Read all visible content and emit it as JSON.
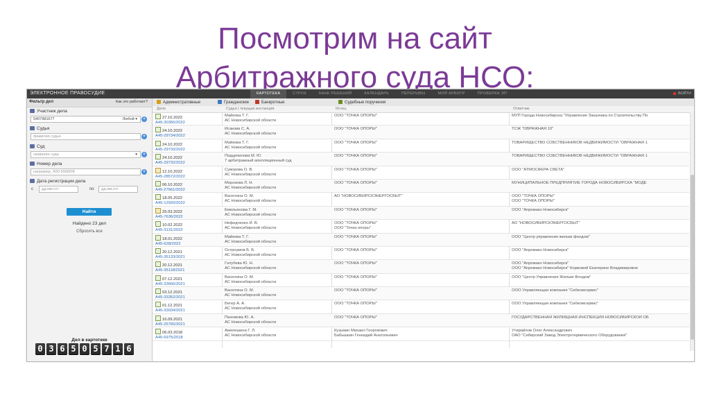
{
  "slide": {
    "title_line1": "Посмотрим на сайт",
    "title_line2": "Арбитражного суда НСО:"
  },
  "topbar": {
    "brand": "ЭЛЕКТРОННОЕ ПРАВОСУДИЕ",
    "nav": [
      "КАРТОТЕКА",
      "СТРОК",
      "БАНК РЕШЕНИЙ",
      "КАЛЕНДАРЬ",
      "ПЕРЕРЫВЫ",
      "МОЙ АРБИТР",
      "ПРОВЕРКА ЭП"
    ],
    "login": "ВОЙТИ"
  },
  "sidebar": {
    "title": "Фильтр дел",
    "help": "Как это работает?",
    "participant_label": "Участник дела",
    "participant_value": "5407981677",
    "participant_select": "Любой",
    "judge_label": "Судья",
    "judge_placeholder": "фамилия судьи",
    "court_label": "Суд",
    "court_placeholder": "название суда",
    "case_number_label": "Номер дела",
    "case_number_placeholder": "например, А50-5568/08",
    "reg_date_label": "Дата регистрации дела",
    "date_from": "с",
    "date_to": "по",
    "date_placeholder": "дд.мм.гггг",
    "find_button": "Найти",
    "found_text": "Найдено 23 дел",
    "reset_link": "Сбросить все",
    "counter_label": "Дел в картотеке",
    "counter_digits": [
      "0",
      "3",
      "6",
      "5",
      "0",
      "5",
      "7",
      "1",
      "6"
    ]
  },
  "tabs": [
    {
      "label": "Административные",
      "color": "#d4a017"
    },
    {
      "label": "Гражданские",
      "color": "#3b78c4"
    },
    {
      "label": "Банкротные",
      "color": "#c0392b"
    },
    {
      "label": "Судебные поручения",
      "color": "#6b8e23"
    }
  ],
  "columns": {
    "case": "Дело",
    "court": "Судья | текущая инстанция",
    "plaintiff": "Истец",
    "defendant": "Ответчик"
  },
  "rows": [
    {
      "date": "27.10.2022",
      "num": "А45-30365/2022",
      "judge": "Майкова Т. Г.",
      "court": "АС Новосибирской области",
      "plaintiff": "ООО \"ТОЧКА ОПОРЫ\"",
      "plaintiff2": "",
      "def": "МУП Города Новосибирска \"Управление Заказчика по Строительству По",
      "def2": ""
    },
    {
      "date": "24.10.2022",
      "num": "А45-29734/2022",
      "judge": "Исакова С. А.",
      "court": "АС Новосибирской области",
      "plaintiff": "ООО \"ТОЧКА ОПОРЫ\"",
      "plaintiff2": "",
      "def": "ТСЖ \"ОВРАЖНАЯ 10\"",
      "def2": ""
    },
    {
      "date": "24.10.2022",
      "num": "А45-29733/2022",
      "judge": "Майкова Т. Г.",
      "court": "АС Новосибирской области",
      "plaintiff": "ООО \"ТОЧКА ОПОРЫ\"",
      "plaintiff2": "",
      "def": "ТОВАРИЩЕСТВО СОБСТВЕННИКОВ НЕДВИЖИМОСТИ \"ОВРАЖНАЯ 1",
      "def2": ""
    },
    {
      "date": "24.10.2022",
      "num": "А45-29732/2022",
      "judge": "Подцепилова М. Ю.",
      "court": "7 арбитражный апелляционный суд",
      "plaintiff": "ООО \"ТОЧКА ОПОРЫ\"",
      "plaintiff2": "",
      "def": "ТОВАРИЩЕСТВО СОБСТВЕННИКОВ НЕДВИЖИМОСТИ \"ОВРАЖНАЯ 1",
      "def2": ""
    },
    {
      "date": "12.10.2022",
      "num": "А45-28572/2022",
      "judge": "Суворова О. В.",
      "court": "АС Новосибирской области",
      "plaintiff": "ООО \"ТОЧКА ОПОРЫ\"",
      "plaintiff2": "",
      "def": "ООО \"АТМОСФЕРА СВЕТА\"",
      "def2": "",
      "alt": true
    },
    {
      "date": "06.10.2022",
      "num": "А45-27661/2022",
      "judge": "Морозова Л. Н.",
      "court": "АС Новосибирской области",
      "plaintiff": "ООО \"ТОЧКА ОПОРЫ\"",
      "plaintiff2": "",
      "def": "МУНИЦИПАЛЬНОЕ ПРЕДПРИЯТИЕ ГОРОДА НОВОСИБИРСКА \"МОДЕ",
      "def2": ""
    },
    {
      "date": "18.05.2022",
      "num": "А45-12920/2022",
      "judge": "Васютина О. М.",
      "court": "АС Новосибирской области",
      "plaintiff": "АО \"НОВОСИБИРСКЭНЕРГОСБЫТ\"",
      "plaintiff2": "",
      "def": "ООО \"ТОЧКА ОПОРЫ\"",
      "def2": "ООО \"ТОЧКА ОПОРЫ\""
    },
    {
      "date": "25.03.2022",
      "num": "А45-7636/2022",
      "judge": "Емельянова Г. М.",
      "court": "АС Новосибирской области",
      "plaintiff": "ООО \"ТОЧКА ОПОРЫ\"",
      "plaintiff2": "",
      "def": "ООО \"Апромако Новосибирск\"",
      "def2": "",
      "alt": true
    },
    {
      "date": "10.02.2022",
      "num": "А45-3131/2022",
      "judge": "Нефедченко И. В.",
      "court": "АС Новосибирской области",
      "plaintiff": "ООО \"ТОЧКА ОПОРЫ\"",
      "plaintiff2": "ООО \"Точка опоры\"",
      "def": "АО \"НОВОСИБИРСКЭНЕРГОСБЫТ\"",
      "def2": ""
    },
    {
      "date": "18.01.2022",
      "num": "А45-628/2022",
      "judge": "Майкова Т. Г.",
      "court": "АС Новосибирской области",
      "plaintiff": "ООО \"ТОЧКА ОПОРЫ\"",
      "plaintiff2": "",
      "def": "ООО \"Центр управления жилым фондом\"",
      "def2": ""
    },
    {
      "date": "20.12.2021",
      "num": "А45-35133/2021",
      "judge": "Остроумов Б. Б.",
      "court": "АС Новосибирской области",
      "plaintiff": "ООО \"ТОЧКА ОПОРЫ\"",
      "plaintiff2": "",
      "def": "ООО \"Апромако Новосибирск\"",
      "def2": ""
    },
    {
      "date": "20.12.2021",
      "num": "А45-35118/2021",
      "judge": "Голубева Ю. Н.",
      "court": "АС Новосибирской области",
      "plaintiff": "ООО \"ТОЧКА ОПОРЫ\"",
      "plaintiff2": "",
      "def": "ООО \"Апромако Новосибирск\"",
      "def2": "ООО \"Апромако Новосибирск\" Коржовой Екатерине Владимировне"
    },
    {
      "date": "07.12.2021",
      "num": "А45-33666/2021",
      "judge": "Васютина О. М.",
      "court": "АС Новосибирской области",
      "plaintiff": "ООО \"ТОЧКА ОПОРЫ\"",
      "plaintiff2": "",
      "def": "ООО \"Центр Управления Жилым Фондом\"",
      "def2": ""
    },
    {
      "date": "03.12.2021",
      "num": "А45-33352/2021",
      "judge": "Васютина О. М.",
      "court": "АС Новосибирской области",
      "plaintiff": "ООО \"ТОЧКА ОПОРЫ\"",
      "plaintiff2": "",
      "def": "ООО Управляющая компания \"Сибкомсервис\"",
      "def2": ""
    },
    {
      "date": "01.12.2021",
      "num": "А45-33034/2021",
      "judge": "Бегер А. А.",
      "court": "АС Новосибирской области",
      "plaintiff": "ООО \"ТОЧКА ОПОРЫ\"",
      "plaintiff2": "",
      "def": "ООО Управляющая компания \"Сибкомсервис\"",
      "def2": ""
    },
    {
      "date": "16.09.2021",
      "num": "А45-25765/2021",
      "judge": "Пахомова Ю. А.",
      "court": "АС Новосибирской области",
      "plaintiff": "ООО \"ТОЧКА ОПОРЫ\"",
      "plaintiff2": "",
      "def": "ГОСУДАРСТВЕННАЯ ЖИЛИЩНАЯ ИНСПЕКЦИЯ НОВОСИБИРСКОЙ ОБ",
      "def2": ""
    },
    {
      "date": "06.03.2018",
      "num": "А45-6975/2018",
      "judge": "Амелешина Г. Л.",
      "court": "АС Новосибирской области",
      "plaintiff": "Кузьмин Михаил Георгиевич",
      "plaintiff2": "Бабышкин Геннадий Анатольевич",
      "def": "Утирайлов Олег Александрович",
      "def2": "ОАО \"Сибирский Завод Электротермического Оборудования\""
    }
  ]
}
